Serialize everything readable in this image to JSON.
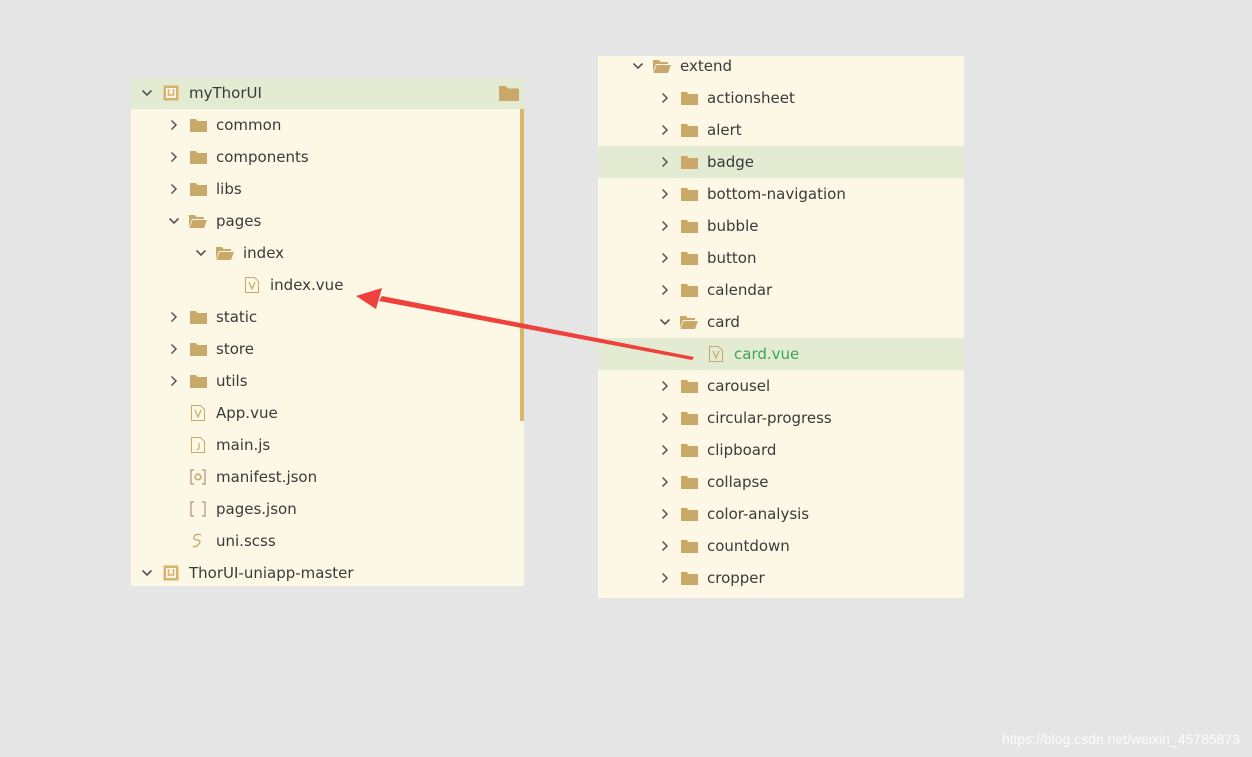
{
  "left_tree": {
    "items": [
      {
        "label": "myThorUI",
        "icon": "project-icon",
        "expander": "chevron-down",
        "depth": 0,
        "selected": true
      },
      {
        "label": "common",
        "icon": "folder-icon",
        "expander": "chevron-right",
        "depth": 1
      },
      {
        "label": "components",
        "icon": "folder-icon",
        "expander": "chevron-right",
        "depth": 1
      },
      {
        "label": "libs",
        "icon": "folder-icon",
        "expander": "chevron-right",
        "depth": 1
      },
      {
        "label": "pages",
        "icon": "folder-open-icon",
        "expander": "chevron-down",
        "depth": 1
      },
      {
        "label": "index",
        "icon": "folder-open-icon",
        "expander": "chevron-down",
        "depth": 2
      },
      {
        "label": "index.vue",
        "icon": "vue-file-icon",
        "expander": "",
        "depth": 3
      },
      {
        "label": "static",
        "icon": "folder-icon",
        "expander": "chevron-right",
        "depth": 1
      },
      {
        "label": "store",
        "icon": "folder-icon",
        "expander": "chevron-right",
        "depth": 1
      },
      {
        "label": "utils",
        "icon": "folder-icon",
        "expander": "chevron-right",
        "depth": 1
      },
      {
        "label": "App.vue",
        "icon": "vue-file-icon",
        "expander": "",
        "depth": 1
      },
      {
        "label": "main.js",
        "icon": "js-file-icon",
        "expander": "",
        "depth": 1
      },
      {
        "label": "manifest.json",
        "icon": "manifest-file-icon",
        "expander": "",
        "depth": 1
      },
      {
        "label": "pages.json",
        "icon": "json-file-icon",
        "expander": "",
        "depth": 1
      },
      {
        "label": "uni.scss",
        "icon": "scss-file-icon",
        "expander": "",
        "depth": 1
      },
      {
        "label": "ThorUI-uniapp-master",
        "icon": "project-icon",
        "expander": "chevron-down",
        "depth": 0
      }
    ]
  },
  "right_tree": {
    "items": [
      {
        "label": "extend",
        "icon": "folder-open-icon",
        "expander": "chevron-down",
        "depth": 0
      },
      {
        "label": "actionsheet",
        "icon": "folder-icon",
        "expander": "chevron-right",
        "depth": 1
      },
      {
        "label": "alert",
        "icon": "folder-icon",
        "expander": "chevron-right",
        "depth": 1
      },
      {
        "label": "badge",
        "icon": "folder-icon",
        "expander": "chevron-right",
        "depth": 1,
        "selected": true
      },
      {
        "label": "bottom-navigation",
        "icon": "folder-icon",
        "expander": "chevron-right",
        "depth": 1
      },
      {
        "label": "bubble",
        "icon": "folder-icon",
        "expander": "chevron-right",
        "depth": 1
      },
      {
        "label": "button",
        "icon": "folder-icon",
        "expander": "chevron-right",
        "depth": 1
      },
      {
        "label": "calendar",
        "icon": "folder-icon",
        "expander": "chevron-right",
        "depth": 1
      },
      {
        "label": "card",
        "icon": "folder-open-icon",
        "expander": "chevron-down",
        "depth": 1
      },
      {
        "label": "card.vue",
        "icon": "vue-file-icon",
        "expander": "",
        "depth": 2,
        "highlighted": true,
        "green": true
      },
      {
        "label": "carousel",
        "icon": "folder-icon",
        "expander": "chevron-right",
        "depth": 1
      },
      {
        "label": "circular-progress",
        "icon": "folder-icon",
        "expander": "chevron-right",
        "depth": 1
      },
      {
        "label": "clipboard",
        "icon": "folder-icon",
        "expander": "chevron-right",
        "depth": 1
      },
      {
        "label": "collapse",
        "icon": "folder-icon",
        "expander": "chevron-right",
        "depth": 1
      },
      {
        "label": "color-analysis",
        "icon": "folder-icon",
        "expander": "chevron-right",
        "depth": 1
      },
      {
        "label": "countdown",
        "icon": "folder-icon",
        "expander": "chevron-right",
        "depth": 1
      },
      {
        "label": "cropper",
        "icon": "folder-icon",
        "expander": "chevron-right",
        "depth": 1
      }
    ]
  },
  "annotation": {
    "arrow_color": "#f0403c",
    "meaning": "card.vue copied to index.vue"
  },
  "watermark": "https://blog.csdn.net/weixin_45785873",
  "colors": {
    "background": "#e5e5e5",
    "panel": "#fdf8e6",
    "selected": "#e3ecd3",
    "folder": "#c9a86a",
    "green_text": "#3aa657"
  }
}
